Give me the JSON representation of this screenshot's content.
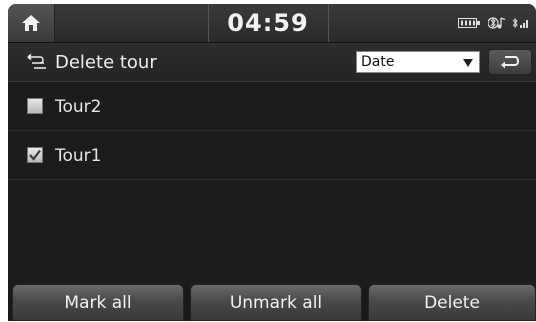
{
  "status_bar": {
    "time": "04:59",
    "icons": [
      "home-icon",
      "usb-icon",
      "bluetooth-audio-icon",
      "bluetooth-signal-icon"
    ]
  },
  "header": {
    "title": "Delete tour",
    "icon": "route-icon",
    "sort": {
      "selected": "Date"
    },
    "back_icon": "back-arrow-icon"
  },
  "tours": [
    {
      "label": "Tour2",
      "checked": false
    },
    {
      "label": "Tour1",
      "checked": true
    }
  ],
  "buttons": {
    "mark_all": "Mark all",
    "unmark_all": "Unmark all",
    "delete": "Delete"
  },
  "colors": {
    "background": "#1c1c1c",
    "text": "#f0f0f0",
    "check": "#3a3a3a"
  }
}
